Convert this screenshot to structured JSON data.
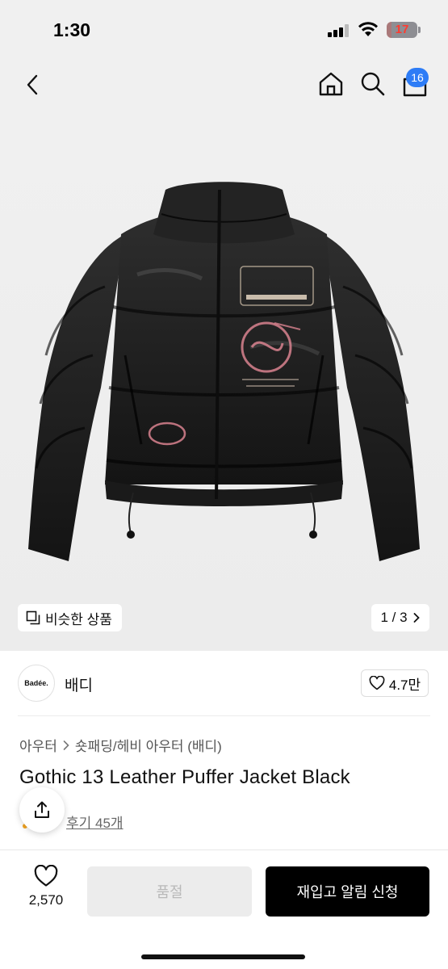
{
  "status_bar": {
    "time": "1:30",
    "battery_level": "17",
    "battery_color": "#ff3b30"
  },
  "nav": {
    "back_icon": "chevron-left-icon",
    "home_icon": "home-icon",
    "search_icon": "search-icon",
    "cart_icon": "shopping-bag-icon",
    "cart_count": "16",
    "badge_color": "#2d7cf6"
  },
  "gallery": {
    "similar_label": "비슷한 상품",
    "page_indicator": "1 / 3",
    "current_page": 1,
    "total_pages": 3
  },
  "brand": {
    "logo_text": "Badée.",
    "name": "배디",
    "like_count": "4.7만"
  },
  "product": {
    "breadcrumb": [
      "아우터",
      "숏패딩/헤비 아우터 (배디)"
    ],
    "title": "Gothic 13 Leather Puffer Jacket Black",
    "reviews": "후기 45개"
  },
  "bottom": {
    "wish_count": "2,570",
    "soldout_label": "품절",
    "restock_label": "재입고 알림 신청"
  }
}
